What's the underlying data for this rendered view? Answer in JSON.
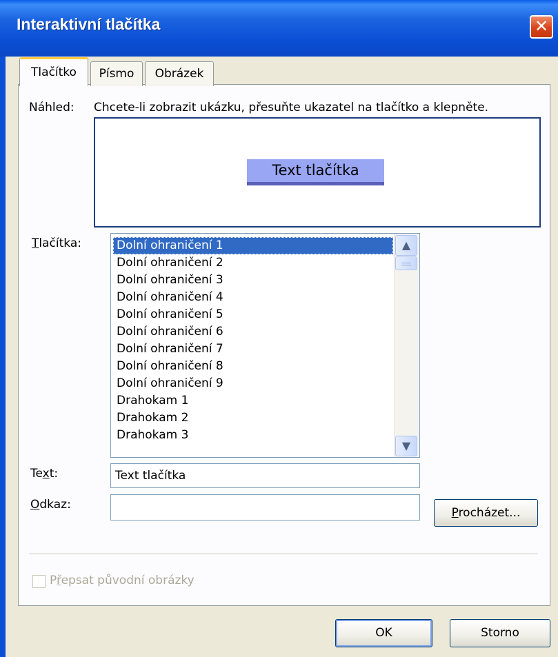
{
  "window": {
    "title": "Interaktivní tlačítka",
    "close_glyph": "✕"
  },
  "tabs": [
    {
      "label": "Tlačítko",
      "active": true
    },
    {
      "label": "Písmo",
      "active": false
    },
    {
      "label": "Obrázek",
      "active": false
    }
  ],
  "preview": {
    "label": "Náhled:",
    "hint": "Chcete-li zobrazit ukázku, přesuňte ukazatel na tlačítko a klepněte.",
    "button_text": "Text tlačítka"
  },
  "buttons_list": {
    "label_mnemonic": "T",
    "label_rest": "lačítka:",
    "selected_index": 0,
    "items": [
      "Dolní ohraničení 1",
      "Dolní ohraničení 2",
      "Dolní ohraničení 3",
      "Dolní ohraničení 4",
      "Dolní ohraničení 5",
      "Dolní ohraničení 6",
      "Dolní ohraničení 7",
      "Dolní ohraničení 8",
      "Dolní ohraničení 9",
      "Drahokam 1",
      "Drahokam 2",
      "Drahokam 3"
    ],
    "scroll_up_glyph": "▲",
    "scroll_down_glyph": "▼"
  },
  "text_field": {
    "label_pre": "Te",
    "label_mnemonic": "x",
    "label_post": "t:",
    "value": "Text tlačítka"
  },
  "link_field": {
    "label_mnemonic": "O",
    "label_rest": "dkaz:",
    "value": ""
  },
  "browse_button": {
    "label_mnemonic": "P",
    "label_rest": "rocházet..."
  },
  "overwrite_checkbox": {
    "label_pre": "P",
    "label_mnemonic": "ř",
    "label_post": "epsat původní obrázky",
    "checked": false,
    "enabled": false
  },
  "footer": {
    "ok_label": "OK",
    "cancel_label": "Storno"
  },
  "colors": {
    "titlebar": "#0b4fd6",
    "selection": "#316ac5",
    "preview_button": "#99a6f4",
    "tab_highlight": "#ffc83c"
  }
}
